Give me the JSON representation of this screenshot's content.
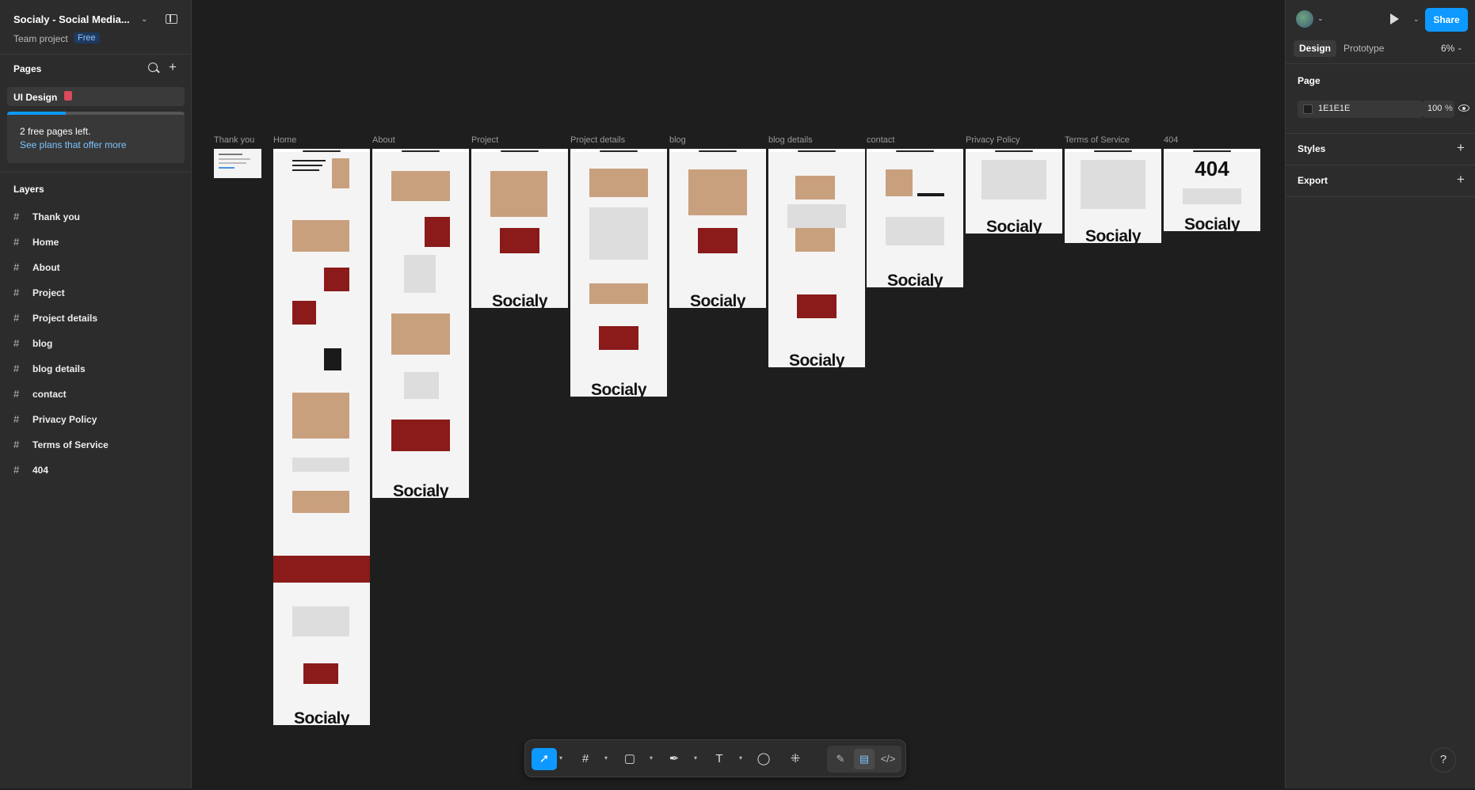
{
  "file": {
    "title": "Socialy - Social Media...",
    "team": "Team project",
    "plan_badge": "Free"
  },
  "pages": {
    "heading": "Pages",
    "current": "UI Design",
    "promo_text": "2 free pages left.",
    "promo_link": "See plans that offer more",
    "promo_progress": 0.33
  },
  "layers": {
    "heading": "Layers",
    "items": [
      "Thank you",
      "Home",
      "About",
      "Project",
      "Project details",
      "blog",
      "blog details",
      "contact",
      "Privacy Policy",
      "Terms of Service",
      "404"
    ]
  },
  "canvas": {
    "frames": [
      "Thank you",
      "Home",
      "About",
      "Project",
      "Project details",
      "blog",
      "blog details",
      "contact",
      "Privacy Policy",
      "Terms of Service",
      "404"
    ],
    "logo_text": "Socialy",
    "notfound_text": "404"
  },
  "right_panel": {
    "share_label": "Share",
    "tab_design": "Design",
    "tab_prototype": "Prototype",
    "zoom": "6%",
    "page_section": "Page",
    "bg_hex": "1E1E1E",
    "bg_opacity": "100",
    "pct": "%",
    "styles_section": "Styles",
    "export_section": "Export"
  },
  "toolbar": {
    "tools": [
      "move-tool",
      "frame-tool",
      "shape-tool",
      "pen-tool",
      "text-tool",
      "comment-tool",
      "actions-tool"
    ],
    "active_tool": "move-tool",
    "modes": [
      "draw-mode",
      "design-mode",
      "dev-mode"
    ],
    "active_mode": "design-mode"
  },
  "help_label": "?",
  "colors": {
    "accent": "#0d99ff",
    "canvas": "#1e1e1e",
    "panel": "#2c2c2c"
  }
}
